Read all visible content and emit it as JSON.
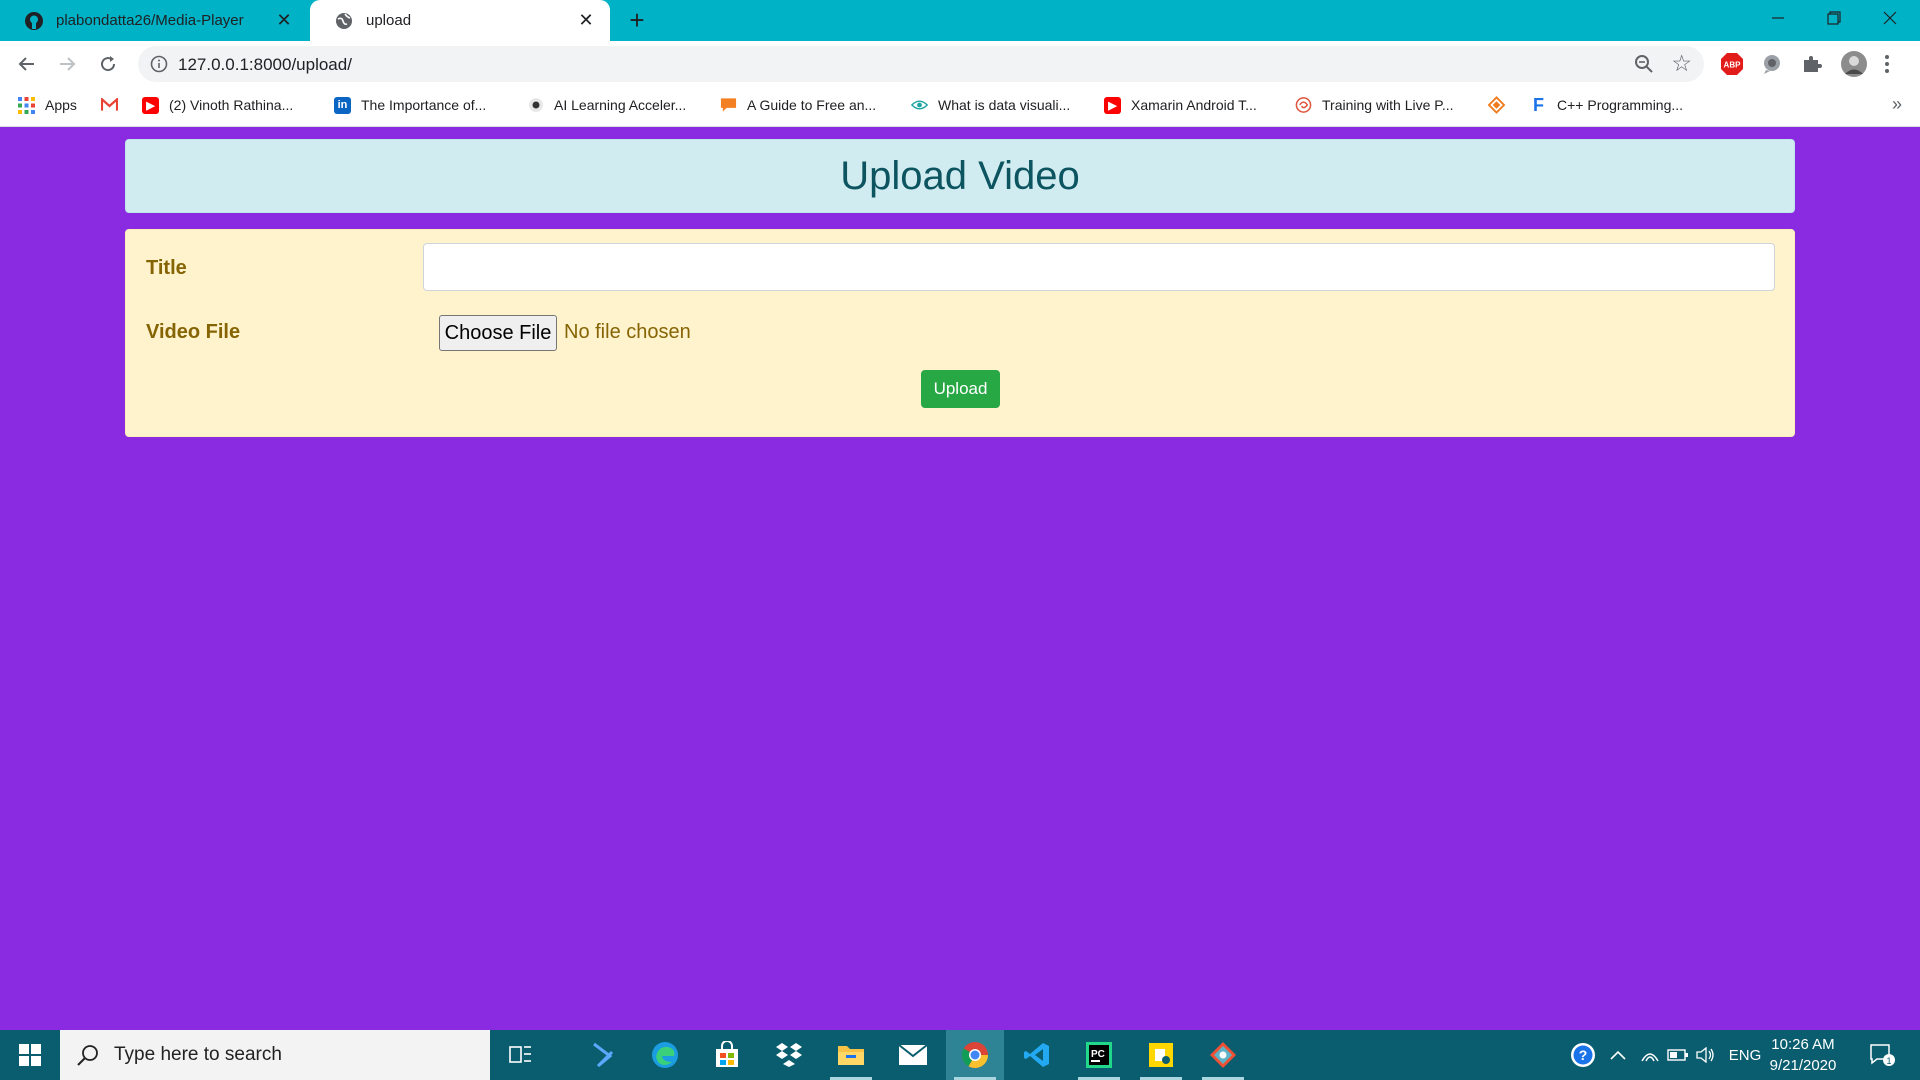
{
  "browser": {
    "tabs": [
      {
        "title": "plabondatta26/Media-Player",
        "active": false
      },
      {
        "title": "upload",
        "active": true
      }
    ],
    "url": "127.0.0.1:8000/upload/",
    "bookmarks": [
      {
        "label": "Apps",
        "icon": "apps-grid-icon"
      },
      {
        "label": "",
        "icon": "gmail-icon"
      },
      {
        "label": "(2) Vinoth Rathina...",
        "icon": "youtube-icon"
      },
      {
        "label": "The Importance of...",
        "icon": "linkedin-icon"
      },
      {
        "label": "AI Learning Acceler...",
        "icon": "dot-icon"
      },
      {
        "label": "A Guide to Free an...",
        "icon": "chat-icon"
      },
      {
        "label": "What is data visuali...",
        "icon": "eye-icon"
      },
      {
        "label": "Xamarin Android T...",
        "icon": "youtube-icon"
      },
      {
        "label": "Training with Live P...",
        "icon": "swirl-icon"
      },
      {
        "label": "",
        "icon": "diamond-icon"
      },
      {
        "label": "C++ Programming...",
        "icon": "f-icon"
      }
    ],
    "more_glyph": "»"
  },
  "page": {
    "heading": "Upload Video",
    "form": {
      "title_label": "Title",
      "title_value": "",
      "video_label": "Video File",
      "file_button": "Choose File",
      "file_status": "No file chosen",
      "submit": "Upload"
    }
  },
  "taskbar": {
    "search_placeholder": "Type here to search",
    "language": "ENG",
    "time": "10:26 AM",
    "date": "9/21/2020",
    "notification_count": "1"
  },
  "colors": {
    "page_bg": "#8a2be2",
    "tabstrip": "#00b2c6",
    "heading_card": "#d1ecf1",
    "heading_text": "#0c5460",
    "form_card": "#fff3cd",
    "label_text": "#856404",
    "upload_button": "#28a745",
    "taskbar": "#0a5d6e"
  }
}
